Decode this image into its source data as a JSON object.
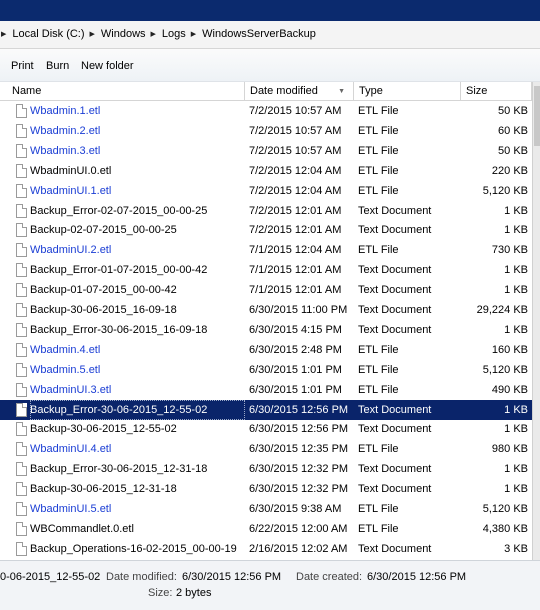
{
  "address": {
    "segments": [
      "Local Disk (C:)",
      "Windows",
      "Logs",
      "WindowsServerBackup"
    ]
  },
  "toolbar": {
    "print_label": "Print",
    "burn_label": "Burn",
    "new_folder_label": "New folder"
  },
  "columns": {
    "name": "Name",
    "date": "Date modified",
    "type": "Type",
    "size": "Size"
  },
  "files": [
    {
      "name": "Wbadmin.1.etl",
      "date": "7/2/2015 10:57 AM",
      "type": "ETL File",
      "size": "50 KB",
      "link": true
    },
    {
      "name": "Wbadmin.2.etl",
      "date": "7/2/2015 10:57 AM",
      "type": "ETL File",
      "size": "60 KB",
      "link": true
    },
    {
      "name": "Wbadmin.3.etl",
      "date": "7/2/2015 10:57 AM",
      "type": "ETL File",
      "size": "50 KB",
      "link": true
    },
    {
      "name": "WbadminUI.0.etl",
      "date": "7/2/2015 12:04 AM",
      "type": "ETL File",
      "size": "220 KB",
      "link": false
    },
    {
      "name": "WbadminUI.1.etl",
      "date": "7/2/2015 12:04 AM",
      "type": "ETL File",
      "size": "5,120 KB",
      "link": true
    },
    {
      "name": "Backup_Error-02-07-2015_00-00-25",
      "date": "7/2/2015 12:01 AM",
      "type": "Text Document",
      "size": "1 KB",
      "link": false
    },
    {
      "name": "Backup-02-07-2015_00-00-25",
      "date": "7/2/2015 12:01 AM",
      "type": "Text Document",
      "size": "1 KB",
      "link": false
    },
    {
      "name": "WbadminUI.2.etl",
      "date": "7/1/2015 12:04 AM",
      "type": "ETL File",
      "size": "730 KB",
      "link": true
    },
    {
      "name": "Backup_Error-01-07-2015_00-00-42",
      "date": "7/1/2015 12:01 AM",
      "type": "Text Document",
      "size": "1 KB",
      "link": false
    },
    {
      "name": "Backup-01-07-2015_00-00-42",
      "date": "7/1/2015 12:01 AM",
      "type": "Text Document",
      "size": "1 KB",
      "link": false
    },
    {
      "name": "Backup-30-06-2015_16-09-18",
      "date": "6/30/2015 11:00 PM",
      "type": "Text Document",
      "size": "29,224 KB",
      "link": false
    },
    {
      "name": "Backup_Error-30-06-2015_16-09-18",
      "date": "6/30/2015 4:15 PM",
      "type": "Text Document",
      "size": "1 KB",
      "link": false
    },
    {
      "name": "Wbadmin.4.etl",
      "date": "6/30/2015 2:48 PM",
      "type": "ETL File",
      "size": "160 KB",
      "link": true
    },
    {
      "name": "Wbadmin.5.etl",
      "date": "6/30/2015 1:01 PM",
      "type": "ETL File",
      "size": "5,120 KB",
      "link": true
    },
    {
      "name": "WbadminUI.3.etl",
      "date": "6/30/2015 1:01 PM",
      "type": "ETL File",
      "size": "490 KB",
      "link": true
    },
    {
      "name": "Backup_Error-30-06-2015_12-55-02",
      "date": "6/30/2015 12:56 PM",
      "type": "Text Document",
      "size": "1 KB",
      "link": false,
      "selected": true
    },
    {
      "name": "Backup-30-06-2015_12-55-02",
      "date": "6/30/2015 12:56 PM",
      "type": "Text Document",
      "size": "1 KB",
      "link": false
    },
    {
      "name": "WbadminUI.4.etl",
      "date": "6/30/2015 12:35 PM",
      "type": "ETL File",
      "size": "980 KB",
      "link": true
    },
    {
      "name": "Backup_Error-30-06-2015_12-31-18",
      "date": "6/30/2015 12:32 PM",
      "type": "Text Document",
      "size": "1 KB",
      "link": false
    },
    {
      "name": "Backup-30-06-2015_12-31-18",
      "date": "6/30/2015 12:32 PM",
      "type": "Text Document",
      "size": "1 KB",
      "link": false
    },
    {
      "name": "WbadminUI.5.etl",
      "date": "6/30/2015 9:38 AM",
      "type": "ETL File",
      "size": "5,120 KB",
      "link": true
    },
    {
      "name": "WBCommandlet.0.etl",
      "date": "6/22/2015 12:00 AM",
      "type": "ETL File",
      "size": "4,380 KB",
      "link": false
    },
    {
      "name": "Backup_Operations-16-02-2015_00-00-19",
      "date": "2/16/2015 12:02 AM",
      "type": "Text Document",
      "size": "3 KB",
      "link": false
    }
  ],
  "details": {
    "filename": "0-06-2015_12-55-02",
    "modified_label": "Date modified:",
    "modified_value": "6/30/2015 12:56 PM",
    "created_label": "Date created:",
    "created_value": "6/30/2015 12:56 PM",
    "size_label": "Size:",
    "size_value": "2 bytes"
  },
  "colors": {
    "titlebar": "#0b2a6e",
    "selection": "#0a246a",
    "link_blue": "#1a3dd4"
  }
}
